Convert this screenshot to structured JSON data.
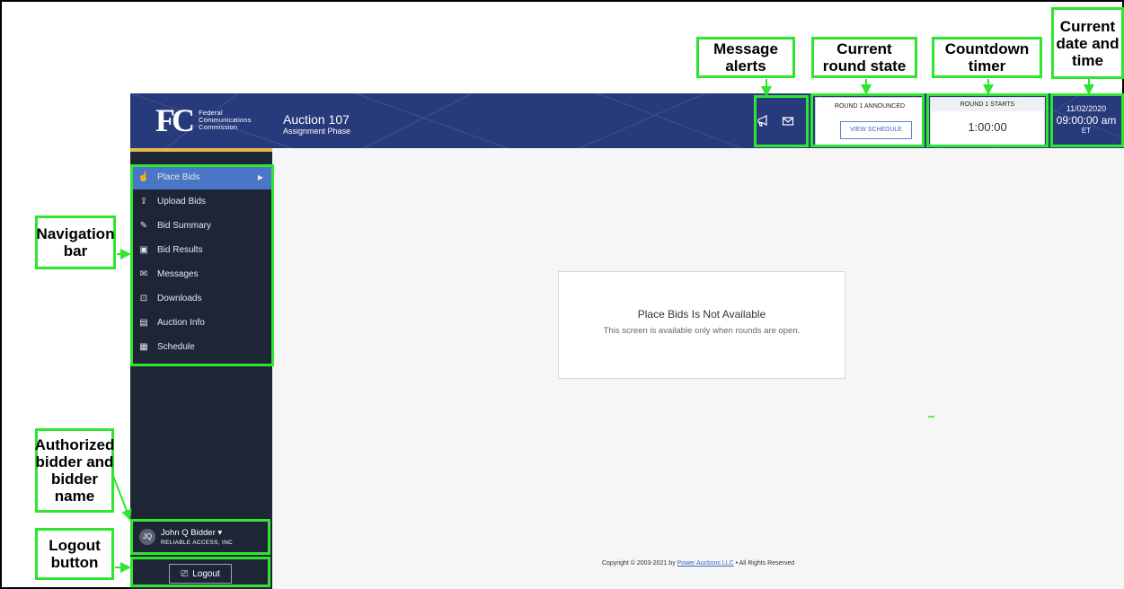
{
  "header": {
    "agency_lines": [
      "Federal",
      "Communications",
      "Commission"
    ],
    "auction_name": "Auction 107",
    "phase": "Assignment Phase",
    "round_state": "ROUND 1 ANNOUNCED",
    "view_schedule": "VIEW SCHEDULE",
    "countdown_label": "ROUND 1 STARTS",
    "countdown_value": "1:00:00",
    "date": "11/02/2020",
    "time": "09:00:00 am",
    "timezone": "ET"
  },
  "nav": {
    "items": [
      {
        "label": "Place Bids",
        "icon": "hand-pointer-icon",
        "active": true
      },
      {
        "label": "Upload Bids",
        "icon": "upload-file-icon"
      },
      {
        "label": "Bid Summary",
        "icon": "edit-icon"
      },
      {
        "label": "Bid Results",
        "icon": "monitor-icon"
      },
      {
        "label": "Messages",
        "icon": "envelope-icon"
      },
      {
        "label": "Downloads",
        "icon": "download-icon"
      },
      {
        "label": "Auction Info",
        "icon": "clipboard-icon"
      },
      {
        "label": "Schedule",
        "icon": "calendar-icon"
      }
    ]
  },
  "user": {
    "initials": "JQ",
    "name": "John Q Bidder",
    "company": "RELIABLE ACCESS, INC"
  },
  "logout_label": "Logout",
  "main": {
    "title": "Place Bids Is Not Available",
    "message": "This screen is available only when rounds are open."
  },
  "footer": {
    "prefix": "Copyright © 2003-2021 by ",
    "link": "Power Auctions LLC",
    "suffix": " • All Rights Reserved"
  },
  "callouts": {
    "message_alerts": "Message alerts",
    "current_round_state": "Current round state",
    "countdown_timer": "Countdown timer",
    "current_date_time": "Current date and time",
    "navigation_bar": "Navigation bar",
    "authorized_bidder": "Authorized bidder and bidder name",
    "logout_button": "Logout button"
  },
  "colors": {
    "header_bg": "#263a7c",
    "sidebar_bg": "#1e2536",
    "active_nav": "#4a76c8",
    "accent_gold": "#e8b84a",
    "callout_green": "#2ee62e"
  }
}
